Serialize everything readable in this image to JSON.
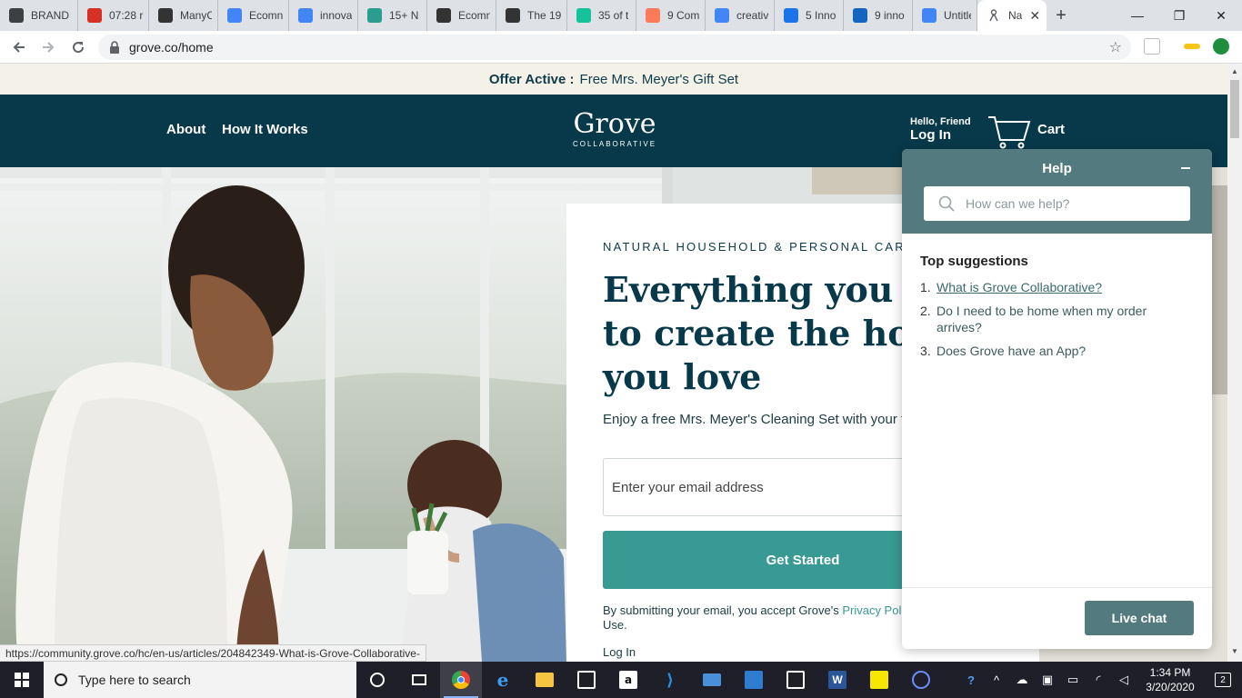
{
  "browser": {
    "tabs": [
      {
        "label": "BRAND",
        "icon": "brand-chevrons-icon",
        "color": "#3c4043"
      },
      {
        "label": "07:28 r",
        "icon": "red-power-icon",
        "color": "#d93025"
      },
      {
        "label": "ManyC",
        "icon": "manychat-icon",
        "color": "#333333"
      },
      {
        "label": "Ecomn",
        "icon": "google-docs-icon",
        "color": "#4285f4"
      },
      {
        "label": "innova",
        "icon": "google-icon",
        "color": "#4285f4"
      },
      {
        "label": "15+ N",
        "icon": "flask-icon",
        "color": "#2a9d8f"
      },
      {
        "label": "Ecomn",
        "icon": "pyramid-icon",
        "color": "#333333"
      },
      {
        "label": "The 19",
        "icon": "pyramid-icon",
        "color": "#333333"
      },
      {
        "label": "35 of t",
        "icon": "grammarly-icon",
        "color": "#15c39a"
      },
      {
        "label": "9 Com",
        "icon": "hubspot-icon",
        "color": "#ff7a59"
      },
      {
        "label": "creativ",
        "icon": "google-icon",
        "color": "#4285f4"
      },
      {
        "label": "5 Inno",
        "icon": "c-letter-icon",
        "color": "#1a73e8"
      },
      {
        "label": "9 inno",
        "icon": "m-letter-icon",
        "color": "#1565c0"
      },
      {
        "label": "Untitle",
        "icon": "google-docs-icon",
        "color": "#4285f4"
      }
    ],
    "active_tab": {
      "label": "Na",
      "close": "✕"
    },
    "new_tab": "+",
    "window_controls": {
      "minimize": "—",
      "maximize": "❐",
      "close": "✕"
    },
    "url": "grove.co/home"
  },
  "offer": {
    "label": "Offer Active :",
    "text": "Free Mrs. Meyer's Gift Set"
  },
  "header": {
    "nav": [
      "About",
      "How It Works"
    ],
    "logo": {
      "name": "Grove",
      "tagline": "COLLABORATIVE"
    },
    "greeting": "Hello, Friend",
    "login": "Log In",
    "cart": "Cart"
  },
  "hero": {
    "eyebrow": "NATURAL HOUSEHOLD & PERSONAL CARE",
    "headline": "Everything you need to create the home you love",
    "subtext": "Enjoy a free Mrs. Meyer's Cleaning Set with your first order.",
    "email_placeholder": "Enter your email address",
    "cta": "Get Started",
    "terms_prefix": "By submitting your email, you accept Grove's ",
    "terms_link": "Privacy Policy and Terms",
    "terms_suffix": " of Use.",
    "login_link": "Log In"
  },
  "status_url": "https://community.grove.co/hc/en-us/articles/204842349-What-is-Grove-Collaborative-",
  "help": {
    "title": "Help",
    "search_placeholder": "How can we help?",
    "suggestions_title": "Top suggestions",
    "suggestions": [
      {
        "num": "1.",
        "text": "What is Grove Collaborative?"
      },
      {
        "num": "2.",
        "text": "Do I need to be home when my order arrives?"
      },
      {
        "num": "3.",
        "text": "Does Grove have an App?"
      }
    ],
    "live_chat": "Live chat"
  },
  "taskbar": {
    "search_placeholder": "Type here to search",
    "time": "1:34 PM",
    "date": "3/20/2020",
    "notifications": "2"
  },
  "colors": {
    "brand_navy": "#08394a",
    "brand_teal": "#389a93",
    "help_slate": "#537a7f",
    "offer_bg": "#f4f1e8"
  }
}
